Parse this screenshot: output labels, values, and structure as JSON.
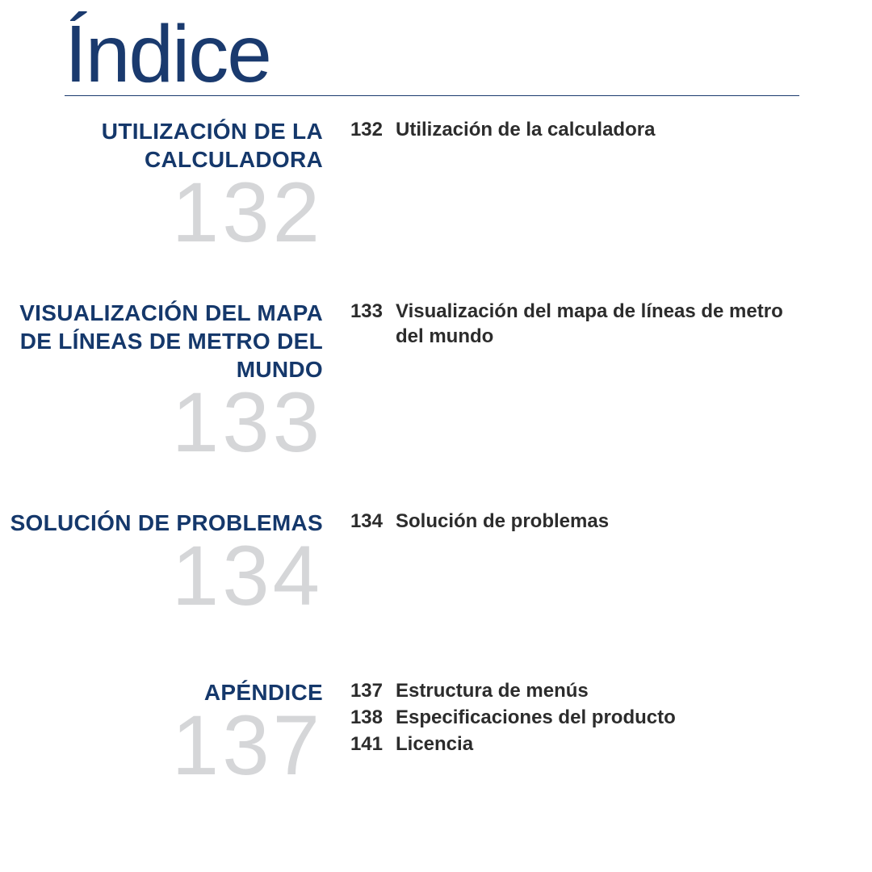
{
  "title": "Índice",
  "sections": [
    {
      "heading": "UTILIZACIÓN DE LA CALCULADORA",
      "page": "132",
      "entries": [
        {
          "page": "132",
          "text": "Utilización de la calculadora"
        }
      ]
    },
    {
      "heading": "VISUALIZACIÓN DEL MAPA DE LÍNEAS DE METRO DEL MUNDO",
      "page": "133",
      "entries": [
        {
          "page": "133",
          "text": "Visualización del mapa de líneas de metro del mundo"
        }
      ]
    },
    {
      "heading": "SOLUCIÓN DE PROBLEMAS",
      "page": "134",
      "entries": [
        {
          "page": "134",
          "text": "Solución de problemas"
        }
      ]
    },
    {
      "heading": "APÉNDICE",
      "page": "137",
      "entries": [
        {
          "page": "137",
          "text": "Estructura de menús"
        },
        {
          "page": "138",
          "text": "Especificaciones del producto"
        },
        {
          "page": "141",
          "text": "Licencia"
        }
      ]
    }
  ]
}
